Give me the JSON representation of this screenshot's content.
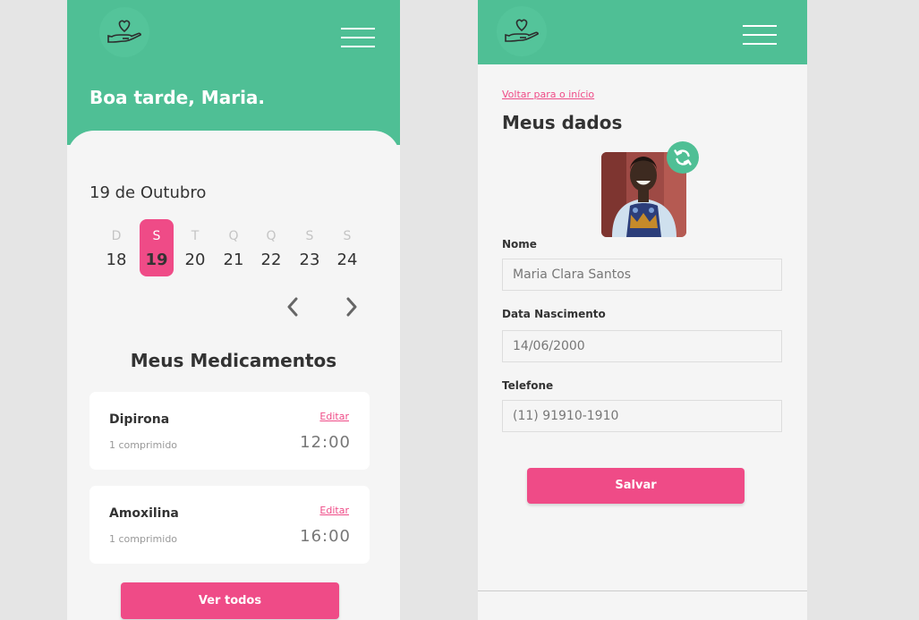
{
  "home": {
    "greeting": "Boa tarde, Maria.",
    "date": "19 de Outubro",
    "week": [
      {
        "letter": "D",
        "num": "18",
        "selected": false
      },
      {
        "letter": "S",
        "num": "19",
        "selected": true
      },
      {
        "letter": "T",
        "num": "20",
        "selected": false
      },
      {
        "letter": "Q",
        "num": "21",
        "selected": false
      },
      {
        "letter": "Q",
        "num": "22",
        "selected": false
      },
      {
        "letter": "S",
        "num": "23",
        "selected": false
      },
      {
        "letter": "S",
        "num": "24",
        "selected": false
      }
    ],
    "section_title": "Meus Medicamentos",
    "medications": [
      {
        "name": "Dipirona",
        "dose": "1 comprimido",
        "edit": "Editar",
        "time": "12:00"
      },
      {
        "name": "Amoxilina",
        "dose": "1 comprimido",
        "edit": "Editar",
        "time": "16:00"
      }
    ],
    "view_all_button": "Ver todos"
  },
  "profile": {
    "back_link": "Voltar para o início",
    "title": "Meus dados",
    "fields": {
      "name": {
        "label": "Nome",
        "value": "Maria Clara Santos"
      },
      "birth": {
        "label": "Data Nascimento",
        "value": "14/06/2000"
      },
      "phone": {
        "label": "Telefone",
        "value": "(11) 91910-1910"
      }
    },
    "save_button": "Salvar"
  },
  "icons": {
    "logo": "heart-hand-icon",
    "menu": "hamburger-menu-icon",
    "prev": "chevron-left-icon",
    "next": "chevron-right-icon",
    "refresh": "refresh-icon"
  },
  "colors": {
    "primary_green": "#4fbf95",
    "accent_pink": "#ef4b87",
    "background": "#f5f5f5"
  }
}
